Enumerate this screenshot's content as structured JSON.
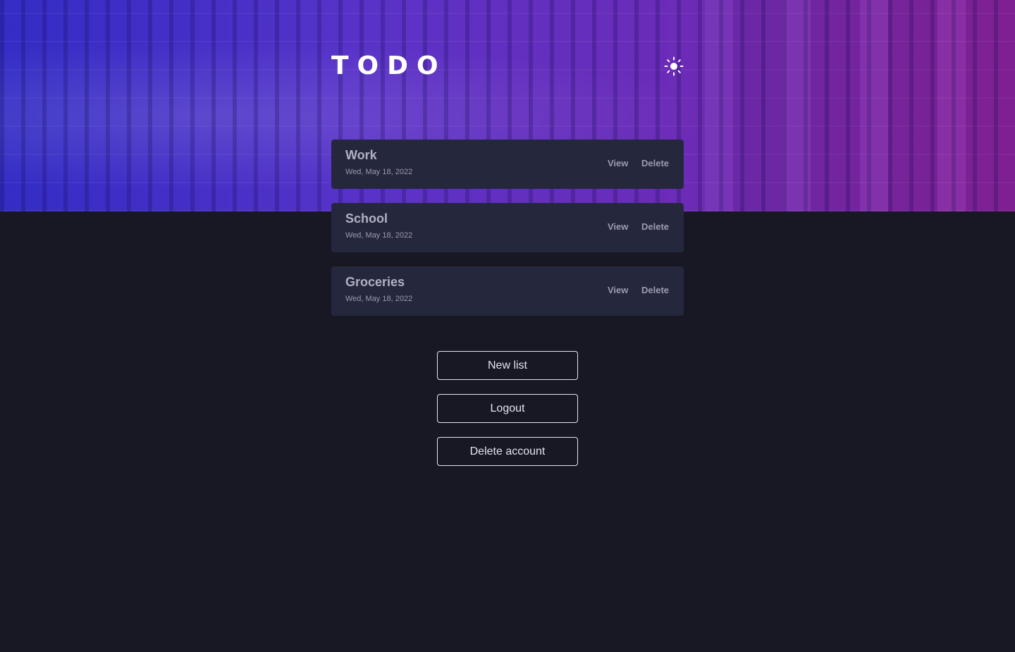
{
  "header": {
    "title": "TODO",
    "theme_icon": "sun-icon"
  },
  "lists": [
    {
      "title": "Work",
      "date": "Wed, May 18, 2022",
      "view_label": "View",
      "delete_label": "Delete"
    },
    {
      "title": "School",
      "date": "Wed, May 18, 2022",
      "view_label": "View",
      "delete_label": "Delete"
    },
    {
      "title": "Groceries",
      "date": "Wed, May 18, 2022",
      "view_label": "View",
      "delete_label": "Delete"
    }
  ],
  "actions": {
    "new_list": "New list",
    "logout": "Logout",
    "delete_account": "Delete account"
  },
  "colors": {
    "background": "#181824",
    "card": "#25273d",
    "hero_start": "#3a2fc4",
    "hero_end": "#87229a",
    "text": "#e4e5f1",
    "muted": "#9a9bb0"
  }
}
